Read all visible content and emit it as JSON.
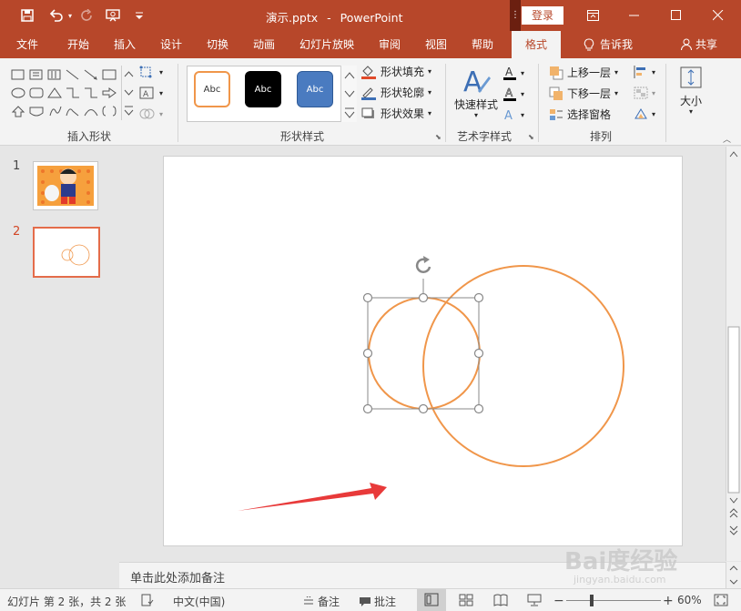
{
  "titlebar": {
    "title_file": "演示.pptx",
    "title_sep": "-",
    "title_app": "PowerPoint",
    "login_label": "登录"
  },
  "tabs": [
    {
      "label": "文件"
    },
    {
      "label": "开始"
    },
    {
      "label": "插入"
    },
    {
      "label": "设计"
    },
    {
      "label": "切换"
    },
    {
      "label": "动画"
    },
    {
      "label": "幻灯片放映"
    },
    {
      "label": "审阅"
    },
    {
      "label": "视图"
    },
    {
      "label": "帮助"
    },
    {
      "label": "格式"
    }
  ],
  "tell_me": "告诉我",
  "share": "共享",
  "ribbon": {
    "insert_shapes_label": "插入形状",
    "shape_styles_label": "形状样式",
    "style_samples": [
      "Abc",
      "Abc",
      "Abc"
    ],
    "fill_label": "形状填充",
    "outline_label": "形状轮廓",
    "effects_label": "形状效果",
    "quick_styles_label": "快速样式",
    "wordart_label": "艺术字样式",
    "bring_forward": "上移一层",
    "send_backward": "下移一层",
    "selection_pane": "选择窗格",
    "arrange_label": "排列",
    "size_label": "大小"
  },
  "thumbnails": [
    {
      "number": "1"
    },
    {
      "number": "2"
    }
  ],
  "notes_placeholder": "单击此处添加备注",
  "statusbar": {
    "slide_info": "幻灯片 第 2 张，共 2 张",
    "language": "中文(中国)",
    "notes_btn": "备注",
    "comments_btn": "批注",
    "zoom": "60%"
  },
  "watermark": "Bai度经验",
  "watermark_sub": "jingyan.baidu.com",
  "colors": {
    "accent": "#b7472a",
    "circle_stroke": "#f0964a",
    "arrow": "#e83a3a"
  }
}
